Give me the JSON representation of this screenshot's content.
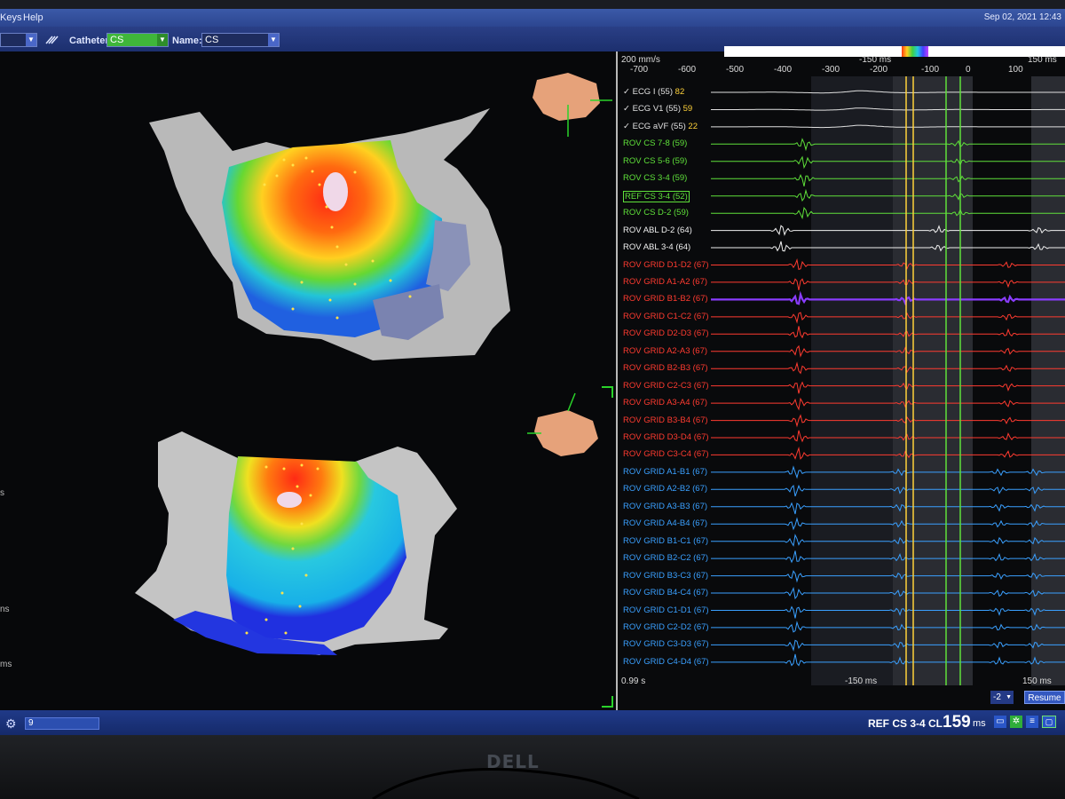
{
  "menubar": {
    "keys": "Keys",
    "help": "Help",
    "datetime": "Sep 02, 2021 12:43"
  },
  "toolbar": {
    "catheter_label": "Catheter:",
    "catheter_value": "CS",
    "name_label": "Name:",
    "name_value": "CS",
    "left_select_value": ""
  },
  "map": {
    "side_labels": [
      "s",
      "ns",
      "ms"
    ]
  },
  "ecg": {
    "speed": "200 mm/s",
    "time_top_left": [
      "-700",
      "-600",
      "-500",
      "-400",
      "-300",
      "-200"
    ],
    "time_top_right": [
      "-150 ms",
      "-100",
      "0",
      "100",
      "150 ms"
    ],
    "traces": [
      {
        "label": "ECG I (55)",
        "check": "✓",
        "value": "82",
        "color": "#e0e0e0"
      },
      {
        "label": "ECG V1 (55)",
        "check": "✓",
        "value": "59",
        "color": "#e0e0e0"
      },
      {
        "label": "ECG aVF (55)",
        "check": "✓",
        "value": "22",
        "color": "#e0e0e0"
      },
      {
        "label": "ROV CS  7-8 (59)",
        "color": "#5fe03a"
      },
      {
        "label": "ROV CS  5-6 (59)",
        "color": "#5fe03a"
      },
      {
        "label": "ROV CS  3-4 (59)",
        "color": "#5fe03a"
      },
      {
        "label": "REF CS  3-4 (52)",
        "color": "#5fe03a",
        "boxed": true
      },
      {
        "label": "ROV CS  D-2 (59)",
        "color": "#5fe03a"
      },
      {
        "label": "ROV ABL  D-2 (64)",
        "color": "#f0f0f0"
      },
      {
        "label": "ROV ABL  3-4 (64)",
        "color": "#f0f0f0"
      },
      {
        "label": "ROV GRID  D1-D2 (67)",
        "color": "#ff3b30"
      },
      {
        "label": "ROV GRID  A1-A2 (67)",
        "color": "#ff3b30"
      },
      {
        "label": "ROV GRID  B1-B2 (67)",
        "color": "#ff3b30",
        "highlight": true
      },
      {
        "label": "ROV GRID  C1-C2 (67)",
        "color": "#ff3b30"
      },
      {
        "label": "ROV GRID  D2-D3 (67)",
        "color": "#ff3b30"
      },
      {
        "label": "ROV GRID  A2-A3 (67)",
        "color": "#ff3b30"
      },
      {
        "label": "ROV GRID  B2-B3 (67)",
        "color": "#ff3b30"
      },
      {
        "label": "ROV GRID  C2-C3 (67)",
        "color": "#ff3b30"
      },
      {
        "label": "ROV GRID  A3-A4 (67)",
        "color": "#ff3b30"
      },
      {
        "label": "ROV GRID  B3-B4 (67)",
        "color": "#ff3b30"
      },
      {
        "label": "ROV GRID  D3-D4 (67)",
        "color": "#ff3b30"
      },
      {
        "label": "ROV GRID  C3-C4 (67)",
        "color": "#ff3b30"
      },
      {
        "label": "ROV GRID  A1-B1 (67)",
        "color": "#3aa0ff"
      },
      {
        "label": "ROV GRID  A2-B2 (67)",
        "color": "#3aa0ff"
      },
      {
        "label": "ROV GRID  A3-B3 (67)",
        "color": "#3aa0ff"
      },
      {
        "label": "ROV GRID  A4-B4 (67)",
        "color": "#3aa0ff"
      },
      {
        "label": "ROV GRID  B1-C1 (67)",
        "color": "#3aa0ff"
      },
      {
        "label": "ROV GRID  B2-C2 (67)",
        "color": "#3aa0ff"
      },
      {
        "label": "ROV GRID  B3-C3 (67)",
        "color": "#3aa0ff"
      },
      {
        "label": "ROV GRID  B4-C4 (67)",
        "color": "#3aa0ff"
      },
      {
        "label": "ROV GRID  C1-D1 (67)",
        "color": "#3aa0ff"
      },
      {
        "label": "ROV GRID  C2-D2 (67)",
        "color": "#3aa0ff"
      },
      {
        "label": "ROV GRID  C3-D3 (67)",
        "color": "#3aa0ff"
      },
      {
        "label": "ROV GRID  C4-D4 (67)",
        "color": "#3aa0ff"
      }
    ],
    "bottom_left": "0.99 s",
    "bottom_mid": "-150 ms",
    "bottom_right": "150 ms",
    "gain_value": "-2",
    "resume_label": "Resume"
  },
  "status": {
    "field_value": "9",
    "ref_label": "REF CS  3-4 CL",
    "cl_value": "159",
    "cl_unit": "ms"
  },
  "colors": {
    "cs": "#5fe03a",
    "grid_red": "#ff3b30",
    "grid_blue": "#3aa0ff",
    "abl": "#f0f0f0",
    "accent_purple": "#8a3cff"
  },
  "brand": "DELL"
}
